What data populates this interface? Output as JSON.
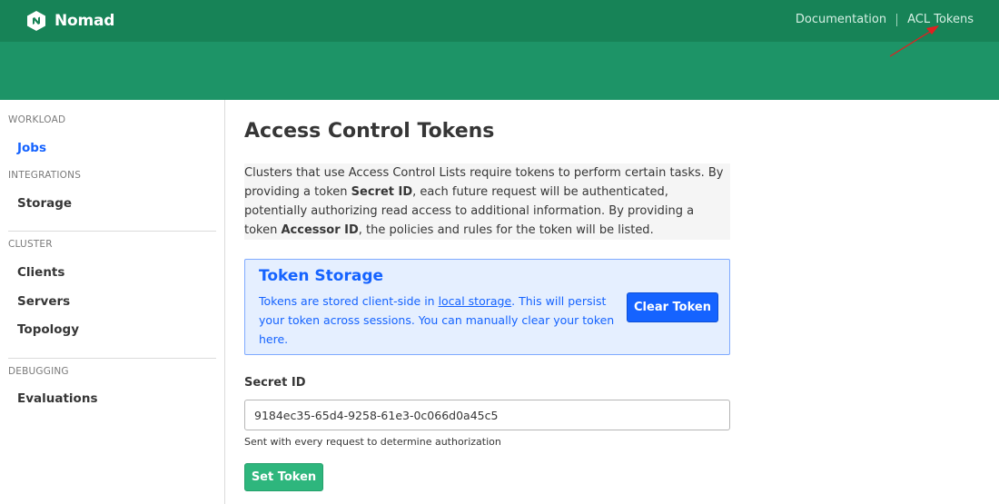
{
  "app": {
    "name": "Nomad"
  },
  "top_nav": {
    "documentation": "Documentation",
    "acl_tokens": "ACL Tokens"
  },
  "sidebar": {
    "sections": [
      {
        "label": "WORKLOAD",
        "items": [
          {
            "label": "Jobs",
            "active": true
          }
        ]
      },
      {
        "label": "INTEGRATIONS",
        "items": [
          {
            "label": "Storage"
          }
        ]
      },
      {
        "label": "CLUSTER",
        "items": [
          {
            "label": "Clients"
          },
          {
            "label": "Servers"
          },
          {
            "label": "Topology"
          }
        ]
      },
      {
        "label": "DEBUGGING",
        "items": [
          {
            "label": "Evaluations"
          }
        ]
      }
    ]
  },
  "main": {
    "title": "Access Control Tokens",
    "intro": {
      "p1": "Clusters that use Access Control Lists require tokens to perform certain tasks. By providing a token ",
      "b1": "Secret ID",
      "p2": ", each future request will be authenticated, potentially authorizing read access to additional information. By providing a token ",
      "b2": "Accessor ID",
      "p3": ", the policies and rules for the token will be listed."
    },
    "token_storage": {
      "title": "Token Storage",
      "text_before": "Tokens are stored client-side in ",
      "link": "local storage",
      "text_after": ". This will persist your token across sessions. You can manually clear your token here.",
      "clear_button": "Clear Token"
    },
    "secret_id": {
      "label": "Secret ID",
      "value": "9184ec35-65d4-9258-61e3-0c066d0a45c5",
      "help": "Sent with every request to determine authorization"
    },
    "set_button": "Set Token"
  },
  "colors": {
    "header": "#1d9467",
    "header_top": "#178357",
    "accent_blue": "#1563ff",
    "set_button": "#2eb67d",
    "annotation_arrow": "#e02020"
  },
  "icons": {
    "logo": "nomad-logo-icon",
    "annotation": "red-arrow-annotation"
  }
}
